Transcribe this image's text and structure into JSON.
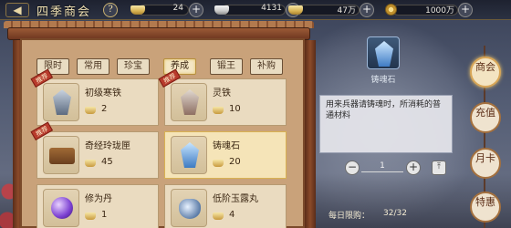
{
  "topbar": {
    "back_icon": "back-arrow-icon",
    "title": "四季商会",
    "help_label": "?",
    "resources": [
      {
        "icon": "gold-ingot-icon",
        "value": "24"
      },
      {
        "icon": "silver-ingot-icon",
        "value": "4131"
      },
      {
        "icon": "gold-ingot-icon",
        "value": "47万"
      },
      {
        "icon": "copper-coin-icon",
        "value": "1000万"
      }
    ]
  },
  "tabs": [
    "限时",
    "常用",
    "珍宝",
    "养成",
    "锻王",
    "补购"
  ],
  "active_tab": 3,
  "items": [
    {
      "name": "初级寒铁",
      "price": "2",
      "badge": "推荐"
    },
    {
      "name": "灵铁",
      "price": "10",
      "badge": "推荐"
    },
    {
      "name": "奇经玲珑匣",
      "price": "45",
      "badge": "推荐"
    },
    {
      "name": "铸魂石",
      "price": "20",
      "badge": ""
    },
    {
      "name": "修为丹",
      "price": "1",
      "badge": ""
    },
    {
      "name": "低阶玉露丸",
      "price": "4",
      "badge": ""
    }
  ],
  "detail": {
    "name": "铸魂石",
    "description": "用来兵器请铸魂时，所消耗的普通材料",
    "quantity": "1",
    "daily_label": "每日限购：",
    "daily_value": "32/32"
  },
  "sidenav": [
    {
      "label": "商会",
      "active": true
    },
    {
      "label": "充值",
      "active": false
    },
    {
      "label": "月卡",
      "active": false
    },
    {
      "label": "特惠",
      "active": false
    }
  ],
  "colors": {
    "accent": "#d8a657",
    "badge": "#b83b2c",
    "panel": "#c9a27a"
  }
}
